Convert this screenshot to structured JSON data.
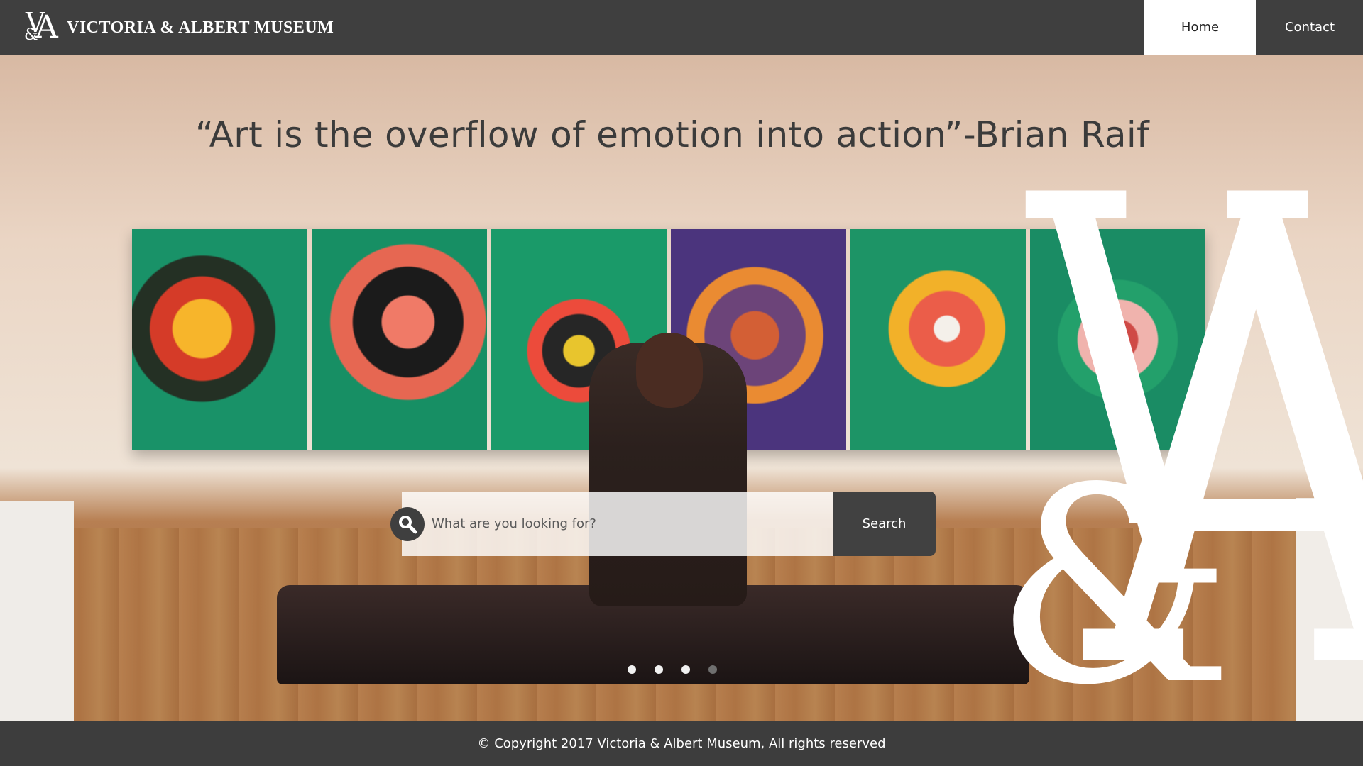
{
  "header": {
    "logo_monogram": "V&A",
    "brand_name": "VICTORIA & ALBERT MUSEUM",
    "nav": {
      "home_label": "Home",
      "contact_label": "Contact"
    }
  },
  "hero": {
    "quote": "“Art is the overflow of emotion into action”-Brian Raif",
    "big_logo_monogram": "V&A"
  },
  "search": {
    "placeholder": "What are you looking for?",
    "button_label": "Search",
    "icon": "search-icon"
  },
  "carousel": {
    "dots": 4,
    "active_index": 0
  },
  "footer": {
    "copyright": "© Copyright 2017 Victoria & Albert Museum, All rights reserved"
  },
  "colors": {
    "header_bg": "#3f3f3f",
    "active_nav_bg": "#ffffff",
    "search_button_bg": "#414141",
    "quote_text": "#3b3b3b"
  }
}
